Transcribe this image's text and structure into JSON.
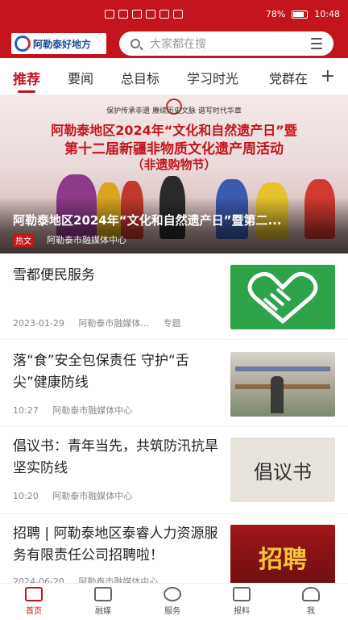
{
  "status_bar": {
    "battery": "78%",
    "time": "10:48"
  },
  "header": {
    "logo_text": "阿勒泰好地方",
    "search_placeholder": "大家都在搜"
  },
  "tabs": [
    {
      "label": "推荐",
      "active": true
    },
    {
      "label": "要闻"
    },
    {
      "label": "总目标"
    },
    {
      "label": "学习时光"
    },
    {
      "label": "党群在"
    }
  ],
  "banner": {
    "motto": "保护传承非遗  赓续历史文脉  谱写时代华章",
    "title_line1": "阿勒泰地区2024年“文化和自然遗产日”暨",
    "title_line2": "第十二届新疆非物质文化遗产周活动",
    "title_line3": "（非遗购物节）",
    "caption": "阿勒泰地区2024年“文化和自然遗产日”暨第二...",
    "tag": "热文",
    "source": "阿勒泰市融媒体中心"
  },
  "news": [
    {
      "title": "雪都便民服务",
      "date": "2023-01-29",
      "source": "阿勒泰市融媒体...",
      "extra": "专题"
    },
    {
      "title": "落“食”安全包保责任 守护“舌尖”健康防线",
      "date": "10:27",
      "source": "阿勒泰市融媒体中心"
    },
    {
      "title": "倡议书：青年当先，共筑防汛抗旱坚实防线",
      "date": "10:20",
      "source": "阿勒泰市融媒体中心",
      "thumb_text": "倡议书"
    },
    {
      "title": "招聘 | 阿勒泰地区泰睿人力资源服务有限责任公司招聘啦！",
      "date": "2024-06-20",
      "source": "阿勒泰市融媒体中心",
      "thumb_text": "招聘"
    }
  ],
  "tabbar": [
    {
      "label": "首页",
      "active": true
    },
    {
      "label": "融媒"
    },
    {
      "label": "服务"
    },
    {
      "label": "报料"
    },
    {
      "label": "我"
    }
  ],
  "colors": {
    "brand_red": "#c3151b",
    "service_green": "#2fa34a"
  }
}
